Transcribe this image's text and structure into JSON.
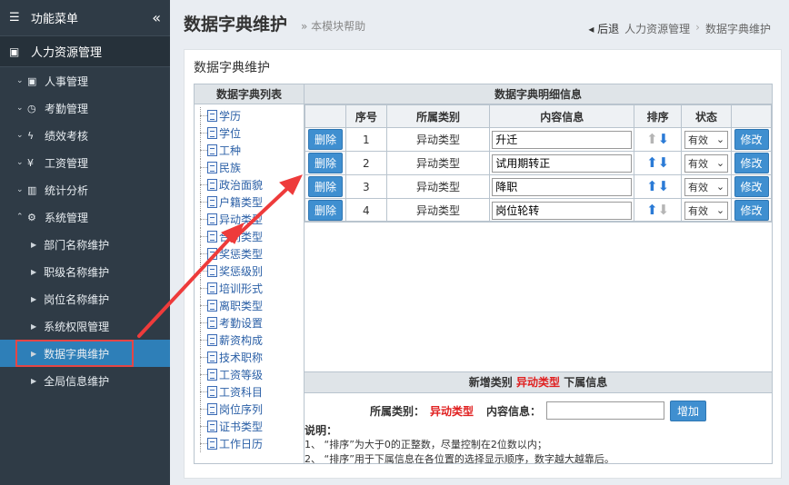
{
  "sidebar": {
    "header": "功能菜单",
    "collapse": "«",
    "module": "人力资源管理",
    "menu": [
      {
        "label": "人事管理",
        "icon": "id-card-icon",
        "glyph": "▣"
      },
      {
        "label": "考勤管理",
        "icon": "clock-icon",
        "glyph": "◷"
      },
      {
        "label": "绩效考核",
        "icon": "bolt-icon",
        "glyph": "ϟ"
      },
      {
        "label": "工资管理",
        "icon": "yen-icon",
        "glyph": "¥"
      },
      {
        "label": "统计分析",
        "icon": "bar-chart-icon",
        "glyph": "▥"
      },
      {
        "label": "系统管理",
        "icon": "gear-icon",
        "glyph": "⚙"
      }
    ],
    "submenu": [
      "部门名称维护",
      "职级名称维护",
      "岗位名称维护",
      "系统权限管理",
      "数据字典维护",
      "全局信息维护"
    ]
  },
  "page": {
    "title": "数据字典维护",
    "help": "» 本模块帮助",
    "breadcrumb": {
      "back": "◂ 后退",
      "parent": "人力资源管理",
      "sep": "›",
      "current": "数据字典维护"
    }
  },
  "panel": {
    "title": "数据字典维护"
  },
  "tree": {
    "header": "数据字典列表",
    "items": [
      "学历",
      "学位",
      "工种",
      "民族",
      "政治面貌",
      "户籍类型",
      "异动类型",
      "合同类型",
      "奖惩类型",
      "奖惩级别",
      "培训形式",
      "离职类型",
      "考勤设置",
      "薪资构成",
      "技术职称",
      "工资等级",
      "工资科目",
      "岗位序列",
      "证书类型",
      "工作日历"
    ]
  },
  "detail": {
    "header": "数据字典明细信息",
    "columns": [
      "",
      "序号",
      "所属类别",
      "内容信息",
      "排序",
      "状态",
      ""
    ],
    "delete_label": "删除",
    "edit_label": "修改",
    "rows": [
      {
        "seq": "1",
        "category": "异动类型",
        "content": "升迁",
        "status": "有效",
        "up": false,
        "down": true
      },
      {
        "seq": "2",
        "category": "异动类型",
        "content": "试用期转正",
        "status": "有效",
        "up": true,
        "down": true
      },
      {
        "seq": "3",
        "category": "异动类型",
        "content": "降职",
        "status": "有效",
        "up": true,
        "down": true
      },
      {
        "seq": "4",
        "category": "异动类型",
        "content": "岗位轮转",
        "status": "有效",
        "up": true,
        "down": false
      }
    ]
  },
  "add": {
    "head_prefix": "新增类别",
    "head_type": "异动类型",
    "head_suffix": "下属信息",
    "category_label": "所属类别：",
    "category_value": "异动类型",
    "content_label": "内容信息：",
    "content_value": "",
    "button": "增加"
  },
  "notes": {
    "title": "说明：",
    "lines": [
      "1、 “排序”为大于0的正整数，尽量控制在2位数以内；",
      "2、 “排序”用于下属信息在各位置的选择显示顺序，数字越大越靠后。"
    ]
  },
  "colors": {
    "sidebar": "#2f3b46",
    "active": "#2e7fb8",
    "button": "#3f8fd0",
    "highlight": "#e02020"
  }
}
